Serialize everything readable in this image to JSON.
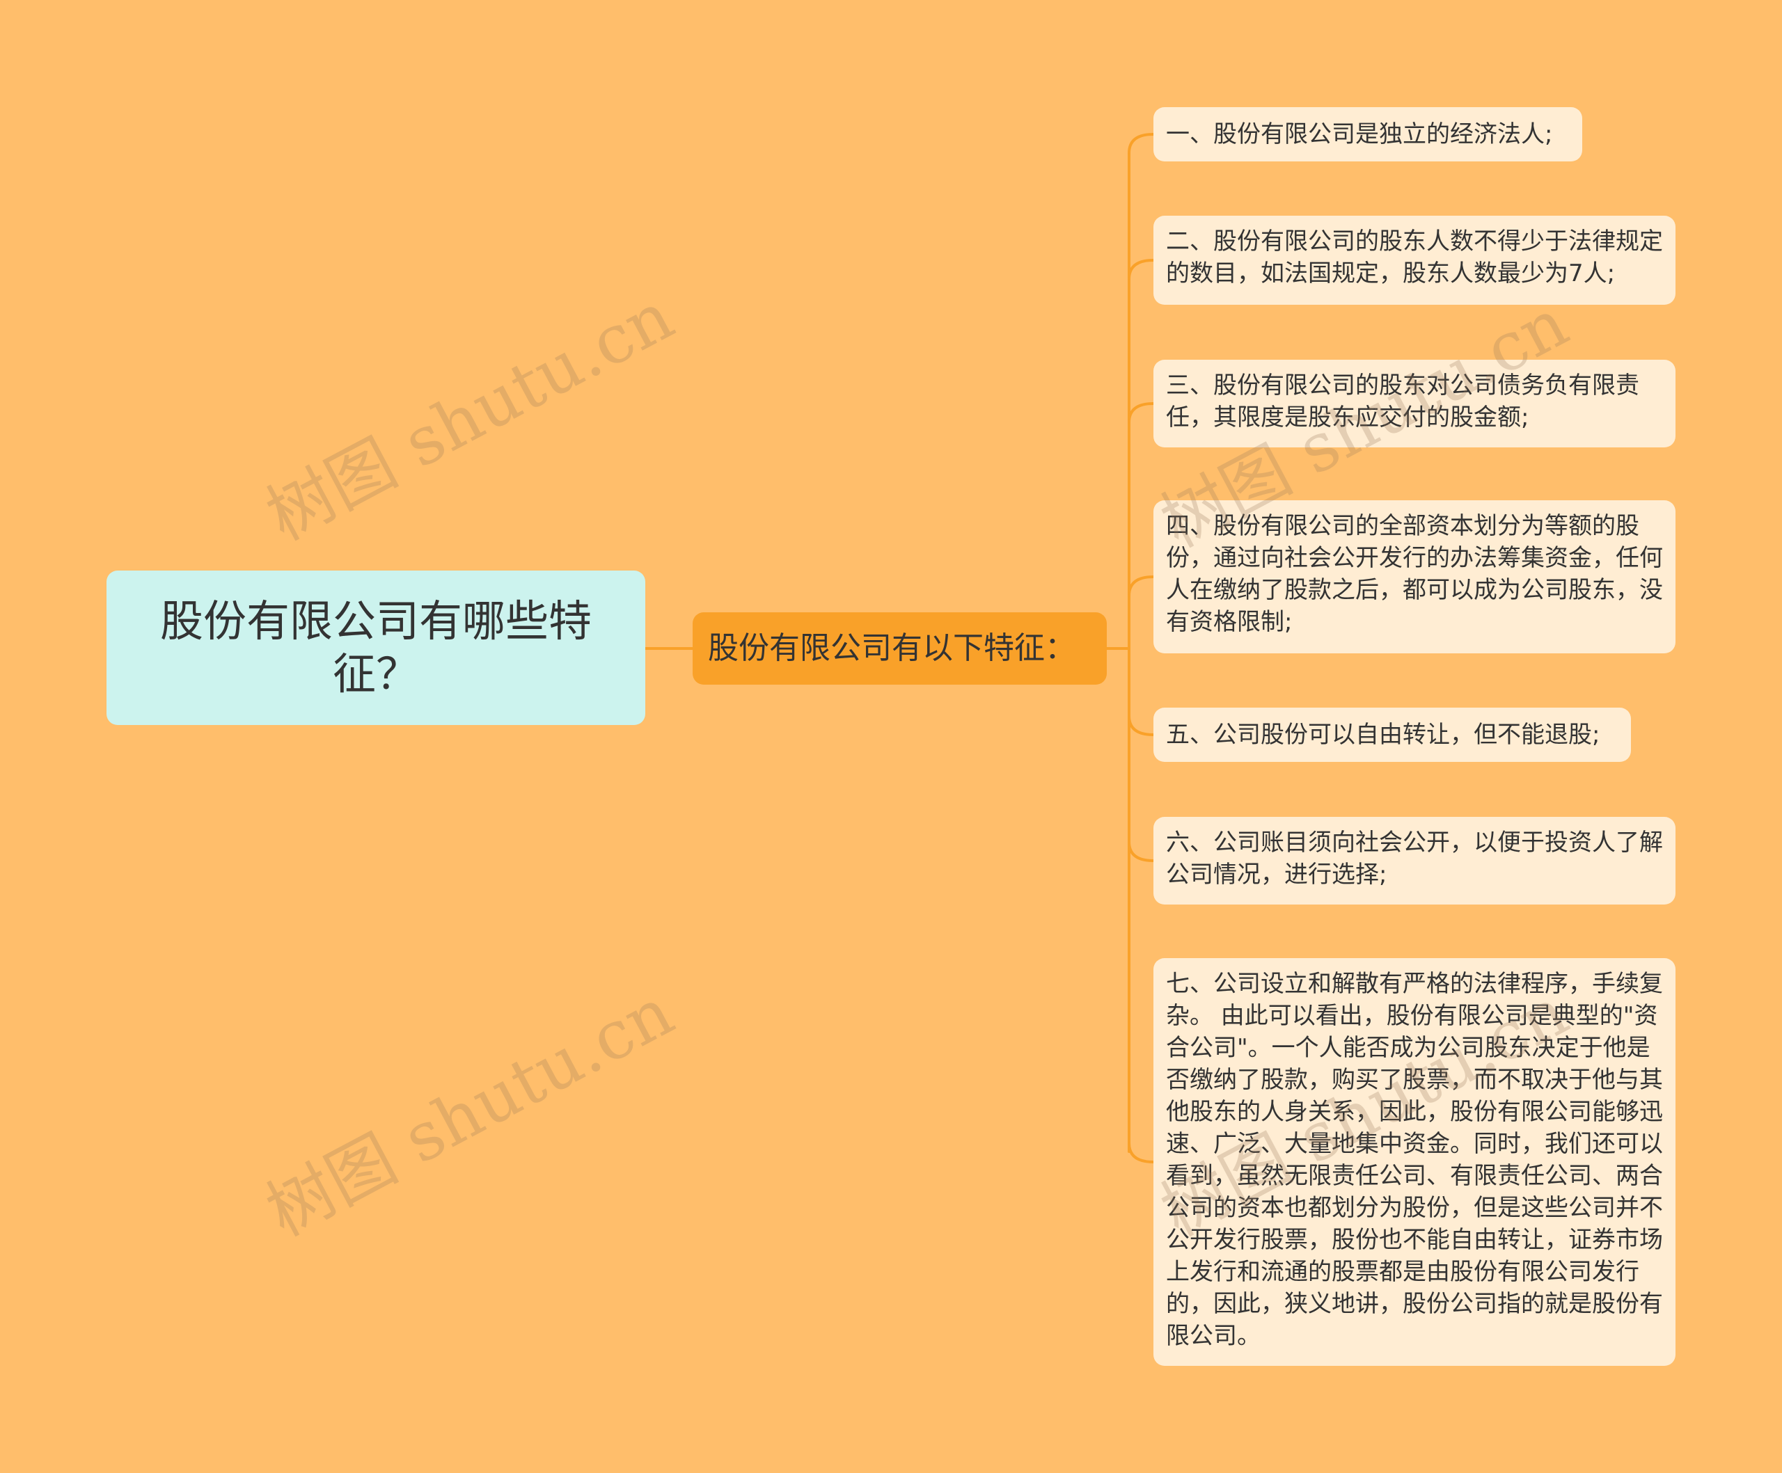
{
  "root": {
    "label": "股份有限公司有哪些特征？"
  },
  "branch": {
    "label": "股份有限公司有以下特征："
  },
  "leaves": [
    "一、股份有限公司是独立的经济法人;",
    "二、股份有限公司的股东人数不得少于法律规定的数目，如法国规定，股东人数最少为7人;",
    "三、股份有限公司的股东对公司债务负有限责任，其限度是股东应交付的股金额;",
    "四、股份有限公司的全部资本划分为等额的股份，通过向社会公开发行的办法筹集资金，任何人在缴纳了股款之后，都可以成为公司股东，没有资格限制;",
    "五、公司股份可以自由转让，但不能退股;",
    "六、公司账目须向社会公开，以便于投资人了解公司情况，进行选择;",
    "七、公司设立和解散有严格的法律程序，手续复杂。 由此可以看出，股份有限公司是典型的\"资合公司\"。一个人能否成为公司股东决定于他是否缴纳了股款，购买了股票，而不取决于他与其他股东的人身关系，因此，股份有限公司能够迅速、广泛、大量地集中资金。同时，我们还可以看到，虽然无限责任公司、有限责任公司、两合公司的资本也都划分为股份，但是这些公司并不公开发行股票，股份也不能自由转让，证券市场上发行和流通的股票都是由股份有限公司发行的，因此，狭义地讲，股份公司指的就是股份有限公司。"
  ],
  "watermark": "树图 shutu.cn",
  "colors": {
    "background": "#FFBE6B",
    "root_fill": "#CCF3EE",
    "branch_fill": "#F9A129",
    "leaf_fill": "#FFEDD3",
    "connector": "#F9A129"
  }
}
